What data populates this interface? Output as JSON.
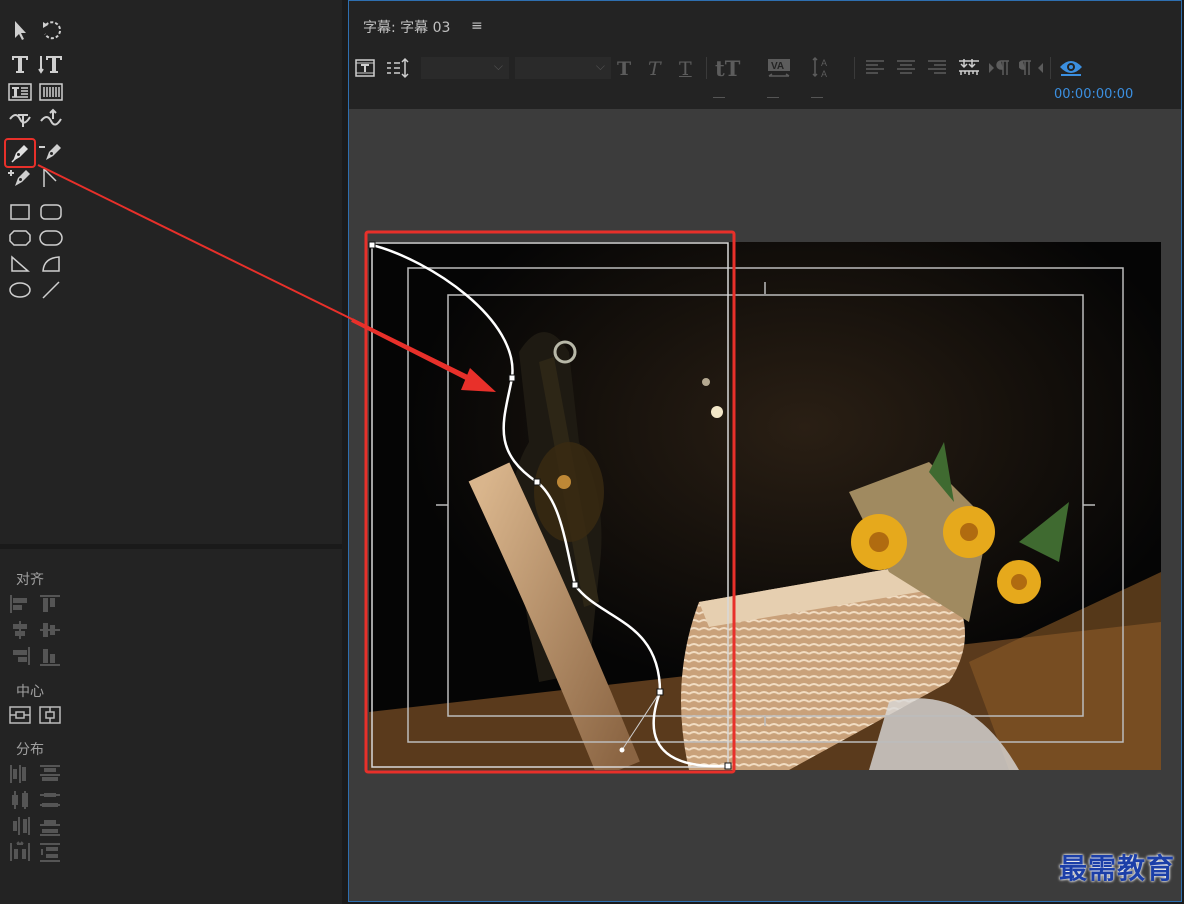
{
  "title_window": {
    "title": "字幕: 字幕 03",
    "menu_icon": "≡",
    "timecode": "00:00:00:00"
  },
  "actions_panel": {
    "align_label": "对齐",
    "center_label": "中心",
    "distribute_label": "分布"
  },
  "watermark": "最需教育",
  "colors": {
    "accent_blue": "#3b8fe0",
    "highlight_red": "#e8302a",
    "panel_bg": "#232323",
    "canvas_bg": "#3c3c3c"
  },
  "tools": [
    "selection-tool",
    "rotation-tool",
    "type-tool",
    "vertical-type-tool",
    "area-type-tool",
    "vertical-area-type-tool",
    "path-type-tool",
    "vertical-path-type-tool",
    "pen-tool",
    "delete-anchor-point-tool",
    "add-anchor-point-tool",
    "convert-anchor-point-tool",
    "rectangle-tool",
    "rounded-corner-rectangle-tool",
    "clipped-corner-rectangle-tool",
    "rounded-rectangle-tool",
    "wedge-tool",
    "arc-tool",
    "ellipse-tool",
    "line-tool"
  ]
}
